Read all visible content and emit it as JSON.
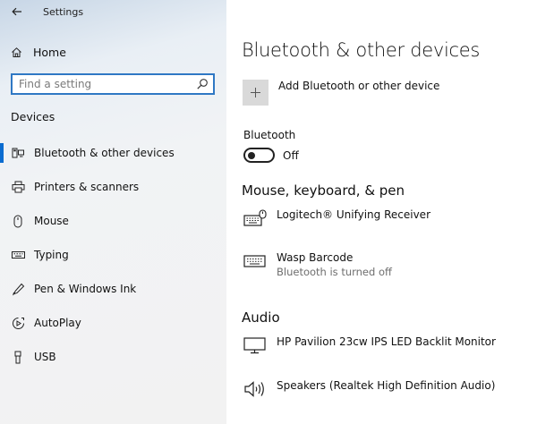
{
  "window": {
    "title": "Settings"
  },
  "sidebar": {
    "home_label": "Home",
    "search_placeholder": "Find a setting",
    "section_label": "Devices",
    "items": [
      {
        "label": "Bluetooth & other devices",
        "icon": "bluetooth-devices-icon",
        "active": true
      },
      {
        "label": "Printers & scanners",
        "icon": "printer-icon"
      },
      {
        "label": "Mouse",
        "icon": "mouse-icon"
      },
      {
        "label": "Typing",
        "icon": "keyboard-icon"
      },
      {
        "label": "Pen & Windows Ink",
        "icon": "pen-icon"
      },
      {
        "label": "AutoPlay",
        "icon": "autoplay-icon"
      },
      {
        "label": "USB",
        "icon": "usb-icon"
      }
    ]
  },
  "main": {
    "title": "Bluetooth & other devices",
    "add_device_label": "Add Bluetooth or other device",
    "bluetooth": {
      "label": "Bluetooth",
      "state": "Off"
    },
    "groups": [
      {
        "title": "Mouse, keyboard, & pen",
        "devices": [
          {
            "name": "Logitech® Unifying Receiver",
            "status": "",
            "icon": "keyboard-mouse-icon"
          },
          {
            "name": "Wasp Barcode",
            "status": "Bluetooth is turned off",
            "icon": "keyboard-icon"
          }
        ]
      },
      {
        "title": "Audio",
        "devices": [
          {
            "name": "HP Pavilion 23cw IPS LED Backlit Monitor",
            "status": "",
            "icon": "monitor-icon"
          },
          {
            "name": "Speakers (Realtek High Definition Audio)",
            "status": "",
            "icon": "speaker-icon"
          }
        ]
      }
    ]
  },
  "colors": {
    "accent": "#0a6cd0",
    "search_border": "#2f78c4",
    "tile": "#d9d9d9"
  }
}
